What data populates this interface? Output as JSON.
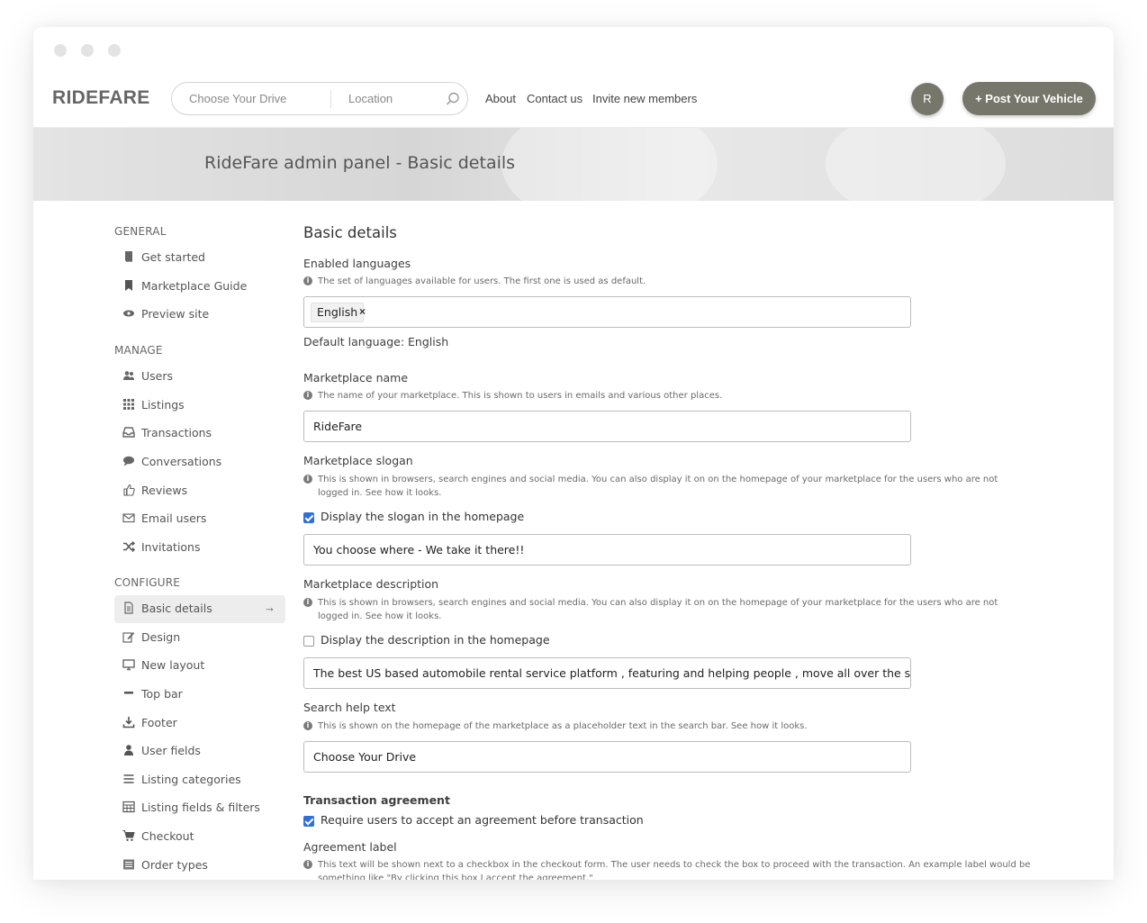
{
  "header": {
    "logo": "RIDEFARE",
    "search": {
      "drive_placeholder": "Choose Your Drive",
      "location_placeholder": "Location"
    },
    "nav": [
      "About",
      "Contact us",
      "Invite new members"
    ],
    "avatar_initial": "R",
    "post_button": "+ Post Your Vehicle"
  },
  "banner": {
    "title": "RideFare admin panel - Basic details"
  },
  "sidebar": {
    "general": {
      "heading": "GENERAL",
      "items": [
        {
          "label": "Get started",
          "icon": "book-icon"
        },
        {
          "label": "Marketplace Guide",
          "icon": "bookmark-icon"
        },
        {
          "label": "Preview site",
          "icon": "eye-icon"
        }
      ]
    },
    "manage": {
      "heading": "MANAGE",
      "items": [
        {
          "label": "Users",
          "icon": "users-icon"
        },
        {
          "label": "Listings",
          "icon": "grid-icon"
        },
        {
          "label": "Transactions",
          "icon": "inbox-icon"
        },
        {
          "label": "Conversations",
          "icon": "chat-icon"
        },
        {
          "label": "Reviews",
          "icon": "thumbs-up-icon"
        },
        {
          "label": "Email users",
          "icon": "envelope-icon"
        },
        {
          "label": "Invitations",
          "icon": "shuffle-icon"
        }
      ]
    },
    "configure": {
      "heading": "CONFIGURE",
      "items": [
        {
          "label": "Basic details",
          "icon": "file-icon",
          "active": true
        },
        {
          "label": "Design",
          "icon": "edit-icon"
        },
        {
          "label": "New layout",
          "icon": "monitor-icon"
        },
        {
          "label": "Top bar",
          "icon": "minus-icon"
        },
        {
          "label": "Footer",
          "icon": "download-icon"
        },
        {
          "label": "User fields",
          "icon": "user-icon"
        },
        {
          "label": "Listing categories",
          "icon": "list-icon"
        },
        {
          "label": "Listing fields & filters",
          "icon": "table-icon"
        },
        {
          "label": "Checkout",
          "icon": "cart-icon"
        },
        {
          "label": "Order types",
          "icon": "list-alt-icon"
        }
      ]
    }
  },
  "main": {
    "title": "Basic details",
    "languages": {
      "label": "Enabled languages",
      "help": "The set of languages available for users. The first one is used as default.",
      "tag": "English",
      "default_text": "Default language: English"
    },
    "name": {
      "label": "Marketplace name",
      "help": "The name of your marketplace. This is shown to users in emails and various other places.",
      "value": "RideFare"
    },
    "slogan": {
      "label": "Marketplace slogan",
      "help": "This is shown in browsers, search engines and social media. You can also display it on on the homepage of your marketplace for the users who are not logged in. See how it looks.",
      "checkbox_label": "Display the slogan in the homepage",
      "checked": true,
      "value": "You choose where - We take it there!!"
    },
    "description": {
      "label": "Marketplace description",
      "help": "This is shown in browsers, search engines and social media. You can also display it on on the homepage of your marketplace for the users who are not logged in. See how it looks.",
      "checkbox_label": "Display the description in the homepage",
      "checked": false,
      "value": "The best US based automobile rental service platform , featuring and helping people , move all over the states . GOD Bl"
    },
    "search_help": {
      "label": "Search help text",
      "help": "This is shown on the homepage of the marketplace as a placeholder text in the search bar. See how it looks.",
      "value": "Choose Your Drive"
    },
    "transaction": {
      "label": "Transaction agreement",
      "checkbox_label": "Require users to accept an agreement before transaction",
      "checked": true
    },
    "agreement": {
      "label": "Agreement label",
      "help": "This text will be shown next to a checkbox in the checkout form. The user needs to check the box to proceed with the transaction. An example label would be something like \"By clicking this box I accept the agreement.\""
    }
  },
  "colors": {
    "accent": "#76766a",
    "checkbox": "#2f6fd8"
  }
}
